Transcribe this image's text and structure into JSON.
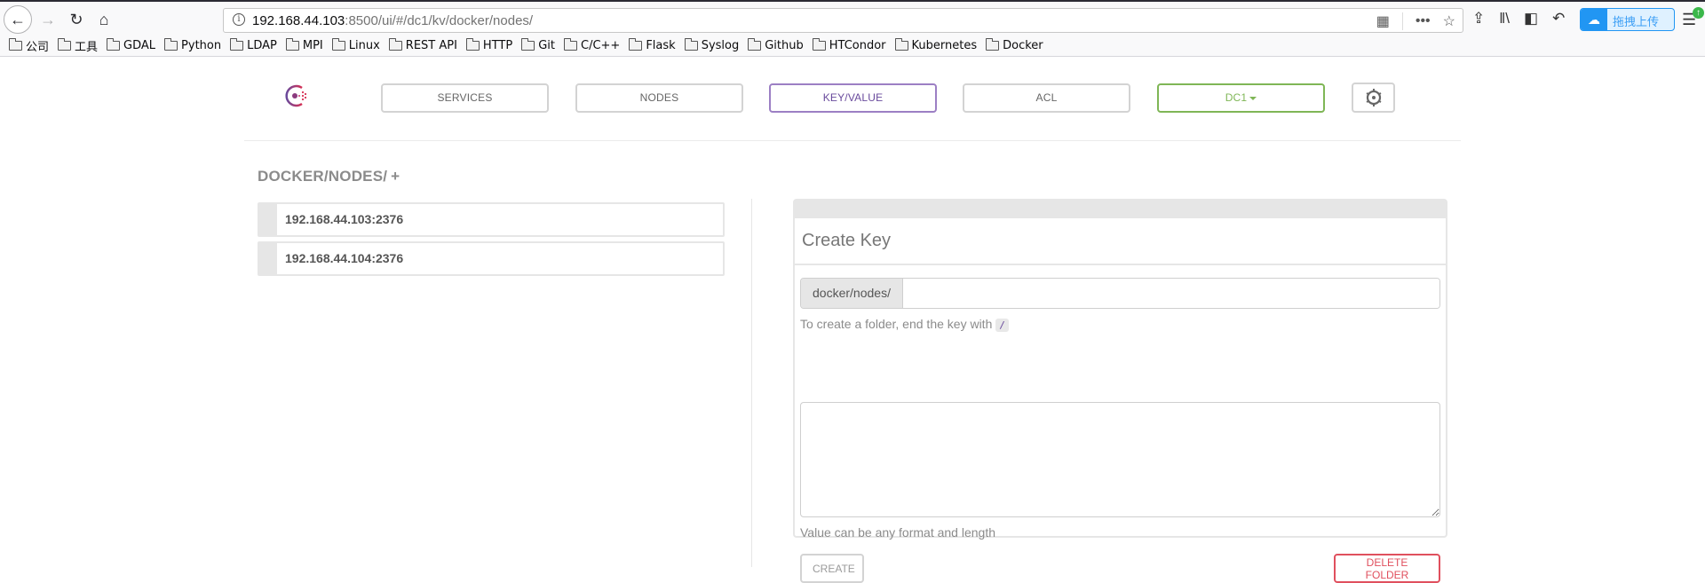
{
  "browser": {
    "url_host": "192.168.44.103",
    "url_rest": ":8500/ui/#/dc1/kv/docker/nodes/",
    "extension_label": "拖拽上传",
    "bookmarks": [
      "公司",
      "工具",
      "GDAL",
      "Python",
      "LDAP",
      "MPI",
      "Linux",
      "REST API",
      "HTTP",
      "Git",
      "C/C++",
      "Flask",
      "Syslog",
      "Github",
      "HTCondor",
      "Kubernetes",
      "Docker"
    ]
  },
  "nav": {
    "services": "SERVICES",
    "nodes": "NODES",
    "keyvalue": "KEY/VALUE",
    "acl": "ACL",
    "datacenter": "DC1",
    "active": "KEY/VALUE",
    "colors": {
      "active": "#694a9c",
      "datacenter": "#7fb656",
      "danger": "#e0505e"
    }
  },
  "kv": {
    "path_title": "DOCKER/NODES/",
    "add_symbol": "+",
    "keys": [
      "192.168.44.103:2376",
      "192.168.44.104:2376"
    ]
  },
  "create_key": {
    "title": "Create Key",
    "prefix": "docker/nodes/",
    "key_value": "",
    "folder_hint": "To create a folder, end the key with",
    "folder_hint_code": "/",
    "value_text": "",
    "value_hint": "Value can be any format and length",
    "create_label": "CREATE",
    "delete_label": "DELETE FOLDER"
  }
}
